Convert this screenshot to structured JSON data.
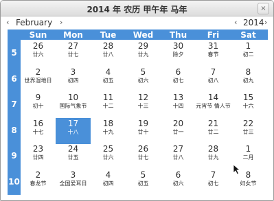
{
  "window": {
    "title": "2014 年 农历 甲午年 马年",
    "close": "×"
  },
  "nav": {
    "prev_month": "‹",
    "month": "February",
    "next_month": "›",
    "prev_year": "‹",
    "year": "2014",
    "next_year": "›"
  },
  "weekdays": [
    "Sun",
    "Mon",
    "Tue",
    "Wed",
    "Thu",
    "Fri",
    "Sat"
  ],
  "weeks": [
    {
      "num": "5",
      "days": [
        {
          "day": "26",
          "lunar": "廿六"
        },
        {
          "day": "27",
          "lunar": "廿七"
        },
        {
          "day": "28",
          "lunar": "廿八"
        },
        {
          "day": "29",
          "lunar": "廿九"
        },
        {
          "day": "30",
          "lunar": "除夕"
        },
        {
          "day": "31",
          "lunar": "春节"
        },
        {
          "day": "1",
          "lunar": "初二"
        }
      ]
    },
    {
      "num": "6",
      "days": [
        {
          "day": "2",
          "lunar": "世界湿地日"
        },
        {
          "day": "3",
          "lunar": "初四"
        },
        {
          "day": "4",
          "lunar": "初五"
        },
        {
          "day": "5",
          "lunar": "初六"
        },
        {
          "day": "6",
          "lunar": "初七"
        },
        {
          "day": "7",
          "lunar": "初八"
        },
        {
          "day": "8",
          "lunar": "初九"
        }
      ]
    },
    {
      "num": "7",
      "days": [
        {
          "day": "9",
          "lunar": "初十"
        },
        {
          "day": "10",
          "lunar": "国际气象节"
        },
        {
          "day": "11",
          "lunar": "十二"
        },
        {
          "day": "12",
          "lunar": "十三"
        },
        {
          "day": "13",
          "lunar": "十四"
        },
        {
          "day": "14",
          "lunar": "元宵节 情人节"
        },
        {
          "day": "15",
          "lunar": "十六"
        }
      ]
    },
    {
      "num": "8",
      "days": [
        {
          "day": "16",
          "lunar": "十七"
        },
        {
          "day": "17",
          "lunar": "十八",
          "selected": true
        },
        {
          "day": "18",
          "lunar": "十九"
        },
        {
          "day": "19",
          "lunar": "廿十"
        },
        {
          "day": "20",
          "lunar": "廿一"
        },
        {
          "day": "21",
          "lunar": "廿二"
        },
        {
          "day": "22",
          "lunar": "廿三"
        }
      ]
    },
    {
      "num": "9",
      "days": [
        {
          "day": "23",
          "lunar": "廿四"
        },
        {
          "day": "24",
          "lunar": "廿五"
        },
        {
          "day": "25",
          "lunar": "廿六"
        },
        {
          "day": "26",
          "lunar": "廿七"
        },
        {
          "day": "27",
          "lunar": "廿八"
        },
        {
          "day": "28",
          "lunar": "廿九"
        },
        {
          "day": "1",
          "lunar": "二月"
        }
      ]
    },
    {
      "num": "10",
      "days": [
        {
          "day": "2",
          "lunar": "春龙节"
        },
        {
          "day": "3",
          "lunar": "全国爱耳日"
        },
        {
          "day": "4",
          "lunar": "初四"
        },
        {
          "day": "5",
          "lunar": "初五"
        },
        {
          "day": "6",
          "lunar": "初六"
        },
        {
          "day": "7",
          "lunar": "初七"
        },
        {
          "day": "8",
          "lunar": "妇女节"
        }
      ]
    }
  ],
  "colors": {
    "accent": "#4a90d9",
    "text": "#2e2e2e"
  },
  "icons": {
    "cursor": "mouse-pointer-icon"
  }
}
